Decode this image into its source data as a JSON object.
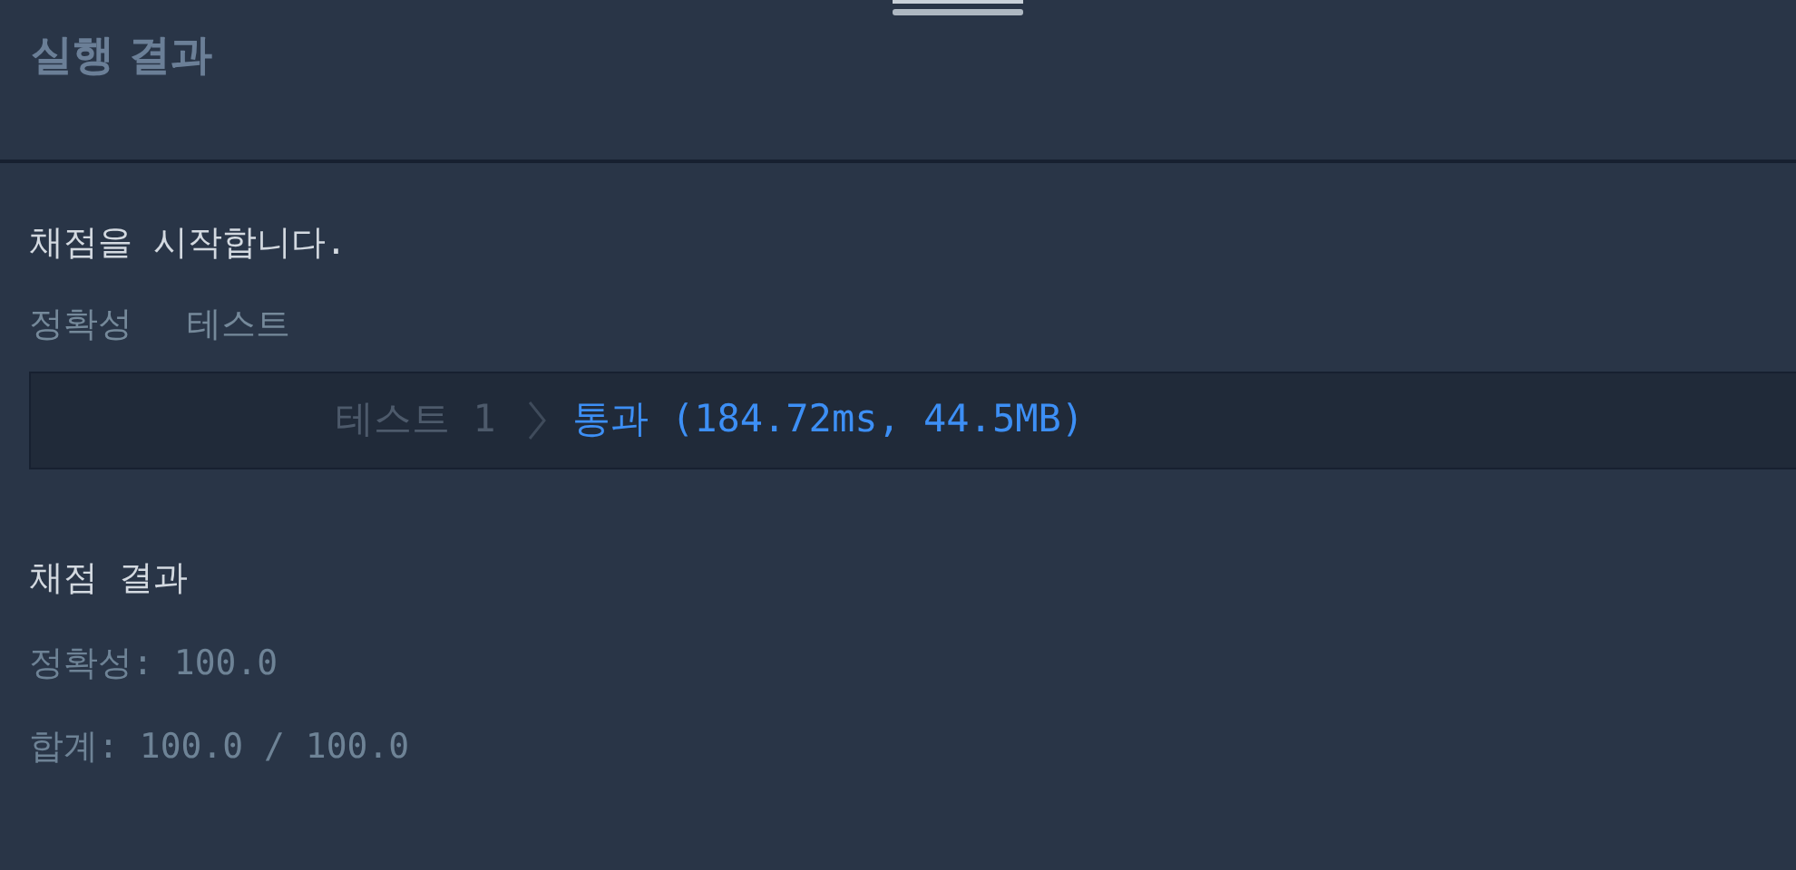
{
  "panel": {
    "title": "실행 결과"
  },
  "output": {
    "message": "채점을 시작합니다.",
    "section_labels": [
      "정확성",
      "테스트"
    ],
    "tests": [
      {
        "label": "테스트 1",
        "passed": true,
        "result": "통과 (184.72ms, 44.5MB)"
      }
    ],
    "summary_title": "채점 결과",
    "summary_lines": [
      "정확성: 100.0",
      "합계: 100.0 / 100.0"
    ]
  }
}
